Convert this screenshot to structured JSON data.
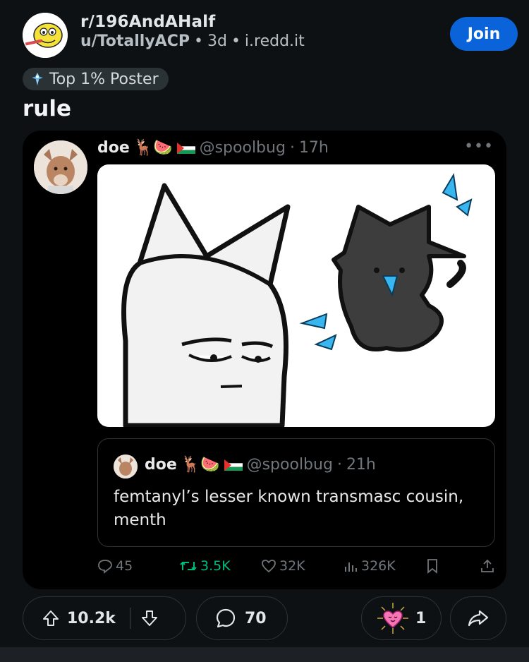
{
  "post": {
    "subreddit": "r/196AndAHalf",
    "user": "u/TotallyACP",
    "age": "3d",
    "domain": "i.redd.it",
    "join_label": "Join",
    "flair": "Top 1% Poster",
    "title": "rule"
  },
  "tweet": {
    "name": "doe",
    "name_emojis": "🦌🍉",
    "handle": "@spoolbug",
    "time": "17h",
    "quote": {
      "name": "doe",
      "name_emojis": "🦌🍉",
      "handle": "@spoolbug",
      "time": "21h",
      "text": "femtanyl’s lesser known transmasc cousin, menth"
    },
    "actions": {
      "replies": "45",
      "retweets": "3.5K",
      "likes": "32K",
      "views": "326K"
    }
  },
  "actions": {
    "score": "10.2k",
    "comments": "70",
    "awards": "1"
  },
  "colors": {
    "background": "#0e1113",
    "join": "#0a63d8",
    "retweet": "#00ba7c",
    "tweet_secondary": "#71767b"
  }
}
